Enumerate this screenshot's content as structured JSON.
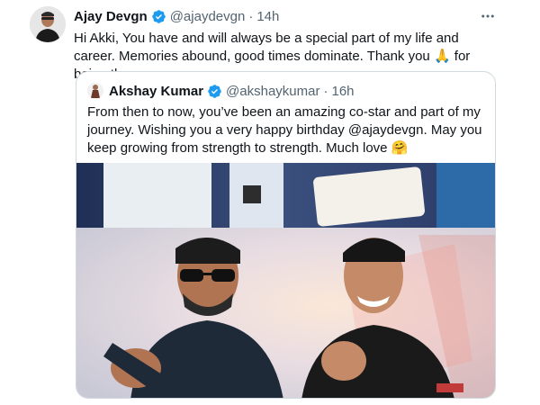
{
  "tweet": {
    "author_name": "Ajay Devgn",
    "author_handle": "@ajaydevgn",
    "separator": "·",
    "time": "14h",
    "text": "Hi Akki, You have and will always be a special part of my life and career. Memories abound, good times dominate. Thank you 🙏 for being there.",
    "more_icon": "more-horizontal-icon"
  },
  "quoted": {
    "author_name": "Akshay Kumar",
    "author_handle": "@akshaykumar",
    "separator": "·",
    "time": "16h",
    "text": "From then to now, you’ve been an amazing co-star and part of my journey. Wishing you a very happy birthday @ajaydevgn. May you keep growing from strength to strength. Much love 🤗"
  },
  "colors": {
    "verified": "#1d9bf0",
    "text_primary": "#0f1419",
    "text_secondary": "#536471",
    "border": "#cfd9de"
  }
}
